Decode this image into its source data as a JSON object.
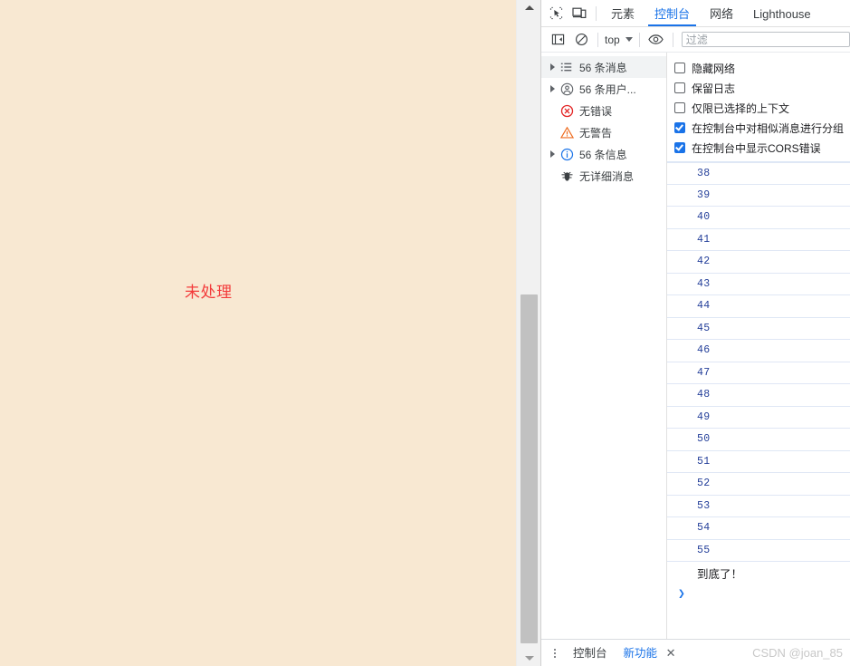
{
  "page": {
    "background_color": "#f8e8d2",
    "text": "未处理",
    "text_color": "#f33b3b"
  },
  "scrollbar": {
    "up_arrow_icon": "triangle-up-icon",
    "down_arrow_icon": "triangle-down-icon"
  },
  "devtools": {
    "toolbar_icons": [
      {
        "name": "inspect-element-icon"
      },
      {
        "name": "device-toolbar-icon"
      }
    ],
    "tabs": [
      {
        "label": "元素",
        "active": false
      },
      {
        "label": "控制台",
        "active": true
      },
      {
        "label": "网络",
        "active": false
      },
      {
        "label": "Lighthouse",
        "active": false
      }
    ],
    "active_tab_color": "#1a73e8",
    "filterbar": {
      "sidebar_toggle_icon": "sidebar-toggle-icon",
      "clear_console_icon": "clear-console-icon",
      "context_value": "top",
      "context_caret_icon": "chevron-down-icon",
      "live_expression_icon": "eye-icon",
      "filter_placeholder": "过滤",
      "filter_value": ""
    },
    "sidebar": {
      "items": [
        {
          "label": "56 条消息",
          "icon": "list-icon",
          "expandable": true,
          "selected": true
        },
        {
          "label": "56 条用户...",
          "icon": "user-message-icon",
          "expandable": true,
          "selected": false
        },
        {
          "label": "无错误",
          "icon": "error-icon",
          "expandable": false,
          "selected": false
        },
        {
          "label": "无警告",
          "icon": "warning-icon",
          "expandable": false,
          "selected": false
        },
        {
          "label": "56 条信息",
          "icon": "info-icon",
          "expandable": true,
          "selected": false
        },
        {
          "label": "无详细消息",
          "icon": "verbose-bug-icon",
          "expandable": false,
          "selected": false
        }
      ]
    },
    "options": [
      {
        "label": "隐藏网络",
        "checked": false
      },
      {
        "label": "保留日志",
        "checked": false
      },
      {
        "label": "仅限已选择的上下文",
        "checked": false
      },
      {
        "label": "在控制台中对相似消息进行分组",
        "checked": true
      },
      {
        "label": "在控制台中显示CORS错误",
        "checked": true
      }
    ],
    "console_log": {
      "entries": [
        "38",
        "39",
        "40",
        "41",
        "42",
        "43",
        "44",
        "45",
        "46",
        "47",
        "48",
        "49",
        "50",
        "51",
        "52",
        "53",
        "54",
        "55"
      ],
      "final_message": "到底了！",
      "prompt_symbol": "❯"
    },
    "drawer": {
      "menu_icon": "more-options-icon",
      "tabs": [
        {
          "label": "控制台",
          "active": false
        },
        {
          "label": "新功能",
          "active": true
        }
      ],
      "close_icon": "close-icon",
      "close_label": "✕"
    }
  },
  "watermark": "CSDN @joan_85"
}
